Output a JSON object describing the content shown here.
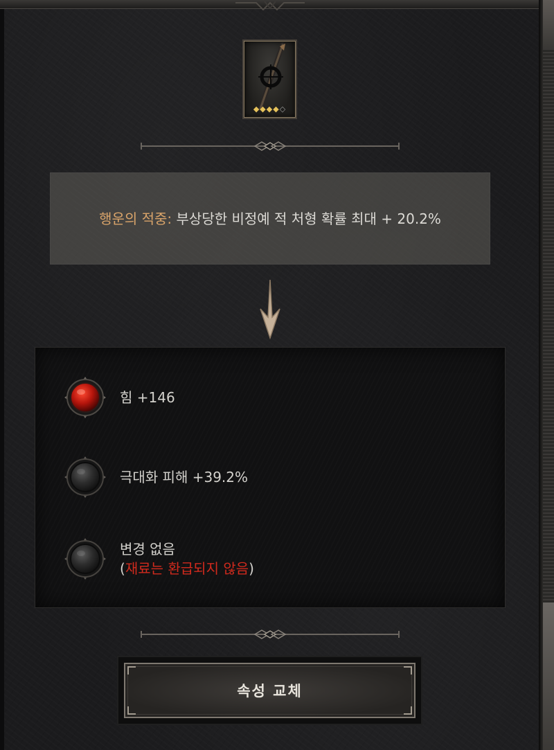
{
  "item": {
    "rarity_filled": "◆◆◆◆",
    "rarity_empty": "◇",
    "icon": "staff-item-icon"
  },
  "current_affix": {
    "name": "행운의 적중:",
    "description": " 부상당한 비정예 적 처형 확률 최대 + 20.2%"
  },
  "options": [
    {
      "label": "힘 +146",
      "orb": "red-orb-icon"
    },
    {
      "label": "극대화 피해 +39.2%",
      "orb": "grey-orb-icon"
    },
    {
      "label": "변경 없음",
      "open_paren": "(",
      "warning": "재료는 환급되지 않음",
      "close_paren": ")",
      "orb": "grey-orb-icon"
    }
  ],
  "action": {
    "replace_label": "속성 교체"
  },
  "colors": {
    "affix_name": "#d9a46a",
    "warning": "#d12a1d",
    "rarity": "#e6c25a"
  }
}
